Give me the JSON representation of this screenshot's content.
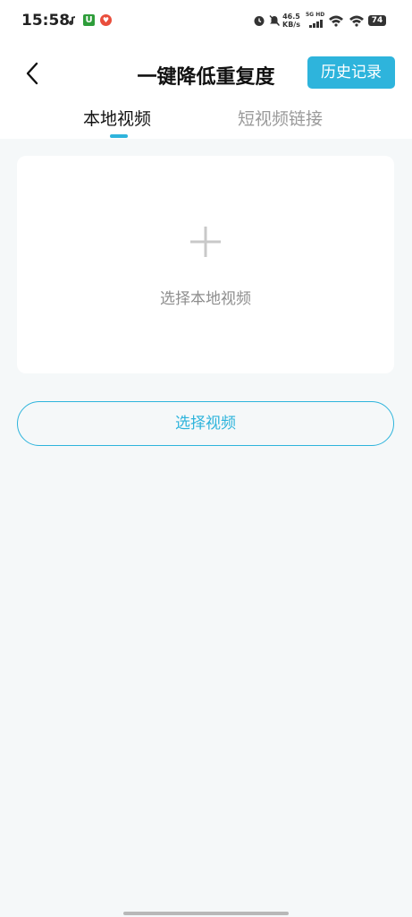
{
  "status_bar": {
    "time": "15:58",
    "app_icon_1": "U",
    "net_speed_value": "46.5",
    "net_speed_unit": "KB/s",
    "signal_label": "5G HD",
    "battery_level": "74"
  },
  "nav": {
    "title": "一键降低重复度",
    "history_button": "历史记录"
  },
  "tabs": [
    {
      "label": "本地视频",
      "active": true
    },
    {
      "label": "短视频链接",
      "active": false
    }
  ],
  "upload_card": {
    "text": "选择本地视频"
  },
  "select_button": {
    "label": "选择视频"
  },
  "colors": {
    "accent": "#2eb4dc",
    "background": "#f5f8f9"
  }
}
